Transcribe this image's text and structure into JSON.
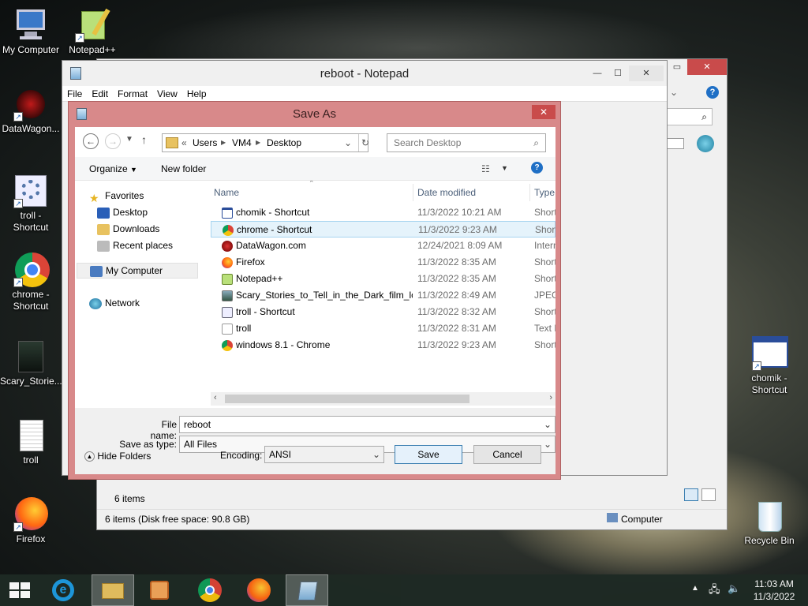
{
  "desktop": {
    "left_icons": [
      {
        "label": "My Computer",
        "icon": "my-computer-icon"
      },
      {
        "label": "Notepad++",
        "icon": "notepadpp-icon"
      },
      {
        "label": "DataWagon...",
        "icon": "datawagon-icon"
      },
      {
        "label": "troll - Shortcut",
        "icon": "gear-shortcut-icon"
      },
      {
        "label": "chrome - Shortcut",
        "icon": "chrome-icon"
      },
      {
        "label": "Scary_Storie...",
        "icon": "image-file-icon"
      },
      {
        "label": "troll",
        "icon": "text-file-icon"
      },
      {
        "label": "Firefox",
        "icon": "firefox-icon"
      }
    ],
    "right_icons": [
      {
        "label": "chomik - Shortcut",
        "icon": "window-shortcut-icon"
      },
      {
        "label": "Recycle Bin",
        "icon": "recycle-bin-icon"
      }
    ]
  },
  "explorer": {
    "status_items": "6 items",
    "status_bar": "6 items (Disk free space: 90.8 GB)",
    "status_location": "Computer"
  },
  "notepad": {
    "title": "reboot - Notepad",
    "menu": [
      "File",
      "Edit",
      "Format",
      "View",
      "Help"
    ]
  },
  "save_as": {
    "title": "Save As",
    "breadcrumb": [
      "Users",
      "VM4",
      "Desktop"
    ],
    "breadcrumb_prefix": "«",
    "search_placeholder": "Search Desktop",
    "organize_label": "Organize",
    "new_folder_label": "New folder",
    "nav": {
      "favorites": "Favorites",
      "favorite_items": [
        "Desktop",
        "Downloads",
        "Recent places"
      ],
      "my_computer": "My Computer",
      "network": "Network"
    },
    "columns": {
      "name": "Name",
      "date": "Date modified",
      "type": "Type"
    },
    "files": [
      {
        "name": "chomik - Shortcut",
        "date": "11/3/2022 10:21 AM",
        "type": "Shortcut",
        "icon": "window-shortcut-icon",
        "selected": false
      },
      {
        "name": "chrome - Shortcut",
        "date": "11/3/2022 9:23 AM",
        "type": "Shortcut",
        "icon": "chrome-icon",
        "selected": true
      },
      {
        "name": "DataWagon.com",
        "date": "12/24/2021 8:09 AM",
        "type": "Internet S",
        "icon": "url-icon",
        "selected": false
      },
      {
        "name": "Firefox",
        "date": "11/3/2022 8:35 AM",
        "type": "Shortcut",
        "icon": "firefox-icon",
        "selected": false
      },
      {
        "name": "Notepad++",
        "date": "11/3/2022 8:35 AM",
        "type": "Shortcut",
        "icon": "notepadpp-icon",
        "selected": false
      },
      {
        "name": "Scary_Stories_to_Tell_in_the_Dark_film_lo...",
        "date": "11/3/2022 8:49 AM",
        "type": "JPEG imag",
        "icon": "image-file-icon",
        "selected": false
      },
      {
        "name": "troll - Shortcut",
        "date": "11/3/2022 8:32 AM",
        "type": "Shortcut",
        "icon": "gear-shortcut-icon",
        "selected": false
      },
      {
        "name": "troll",
        "date": "11/3/2022 8:31 AM",
        "type": "Text Docu",
        "icon": "text-file-icon",
        "selected": false
      },
      {
        "name": "windows 8.1 - Chrome",
        "date": "11/3/2022 9:23 AM",
        "type": "Shortcut",
        "icon": "chrome-icon",
        "selected": false
      }
    ],
    "file_name_label": "File name:",
    "file_name_value": "reboot",
    "save_type_label": "Save as type:",
    "save_type_value": "All Files",
    "hide_folders_label": "Hide Folders",
    "encoding_label": "Encoding:",
    "encoding_value": "ANSI",
    "save_button": "Save",
    "cancel_button": "Cancel"
  },
  "taskbar": {
    "items": [
      "start-icon",
      "internet-explorer-icon",
      "file-explorer-icon",
      "media-player-icon",
      "chrome-icon",
      "firefox-icon",
      "notepad-icon"
    ],
    "time": "11:03 AM",
    "date": "11/3/2022"
  },
  "colors": {
    "dialog_frame": "#d8898a",
    "selection": "#e5f3fb",
    "taskbar": "#1e2a24"
  }
}
